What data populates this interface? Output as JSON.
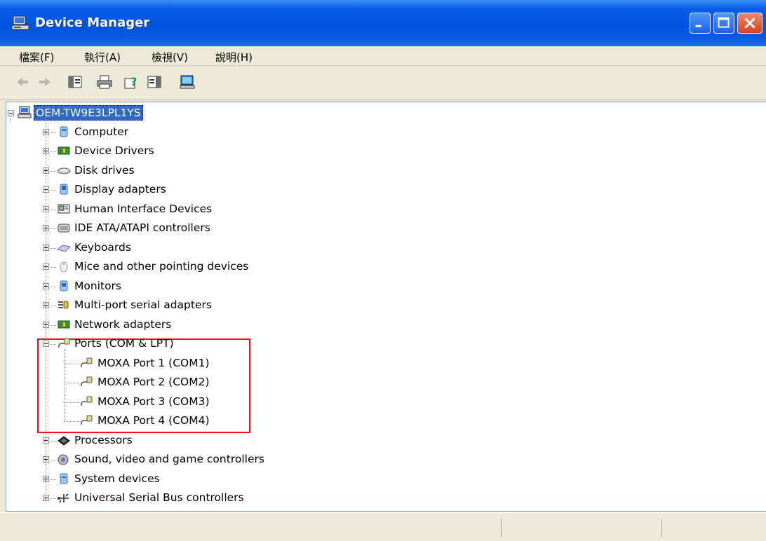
{
  "window": {
    "title": "Device Manager"
  },
  "menu": {
    "items": [
      "檔案(F)",
      "執行(A)",
      "檢視(V)",
      "說明(H)"
    ]
  },
  "toolbar": {
    "buttons": [
      "back-icon",
      "forward-icon",
      "show-hide-tree-icon",
      "print-icon",
      "help-icon",
      "properties-icon",
      "scan-hardware-icon"
    ]
  },
  "tree": {
    "root": "OEM-TW9E3LPL1YS",
    "categories": [
      {
        "label": "Computer",
        "icon": "computer-icon",
        "expanded": false
      },
      {
        "label": "Device Drivers",
        "icon": "driver-icon",
        "expanded": false
      },
      {
        "label": "Disk drives",
        "icon": "disk-icon",
        "expanded": false
      },
      {
        "label": "Display adapters",
        "icon": "display-icon",
        "expanded": false
      },
      {
        "label": "Human Interface Devices",
        "icon": "hid-icon",
        "expanded": false
      },
      {
        "label": "IDE ATA/ATAPI controllers",
        "icon": "ide-icon",
        "expanded": false
      },
      {
        "label": "Keyboards",
        "icon": "keyboard-icon",
        "expanded": false
      },
      {
        "label": "Mice and other pointing devices",
        "icon": "mouse-icon",
        "expanded": false
      },
      {
        "label": "Monitors",
        "icon": "monitor-icon",
        "expanded": false
      },
      {
        "label": "Multi-port serial adapters",
        "icon": "serial-adapter-icon",
        "expanded": false
      },
      {
        "label": "Network adapters",
        "icon": "network-icon",
        "expanded": false
      },
      {
        "label": "Ports (COM & LPT)",
        "icon": "port-icon",
        "expanded": true,
        "children": [
          "MOXA Port 1 (COM1)",
          "MOXA Port 2 (COM2)",
          "MOXA Port 3 (COM3)",
          "MOXA Port 4 (COM4)"
        ]
      },
      {
        "label": "Processors",
        "icon": "processor-icon",
        "expanded": false
      },
      {
        "label": "Sound, video and game controllers",
        "icon": "sound-icon",
        "expanded": false
      },
      {
        "label": "System devices",
        "icon": "system-icon",
        "expanded": false
      },
      {
        "label": "Universal Serial Bus controllers",
        "icon": "usb-icon",
        "expanded": false
      }
    ]
  },
  "colors": {
    "highlight_box": "#e11111",
    "selection": "#316ac5",
    "titlebar": "#0053df"
  }
}
